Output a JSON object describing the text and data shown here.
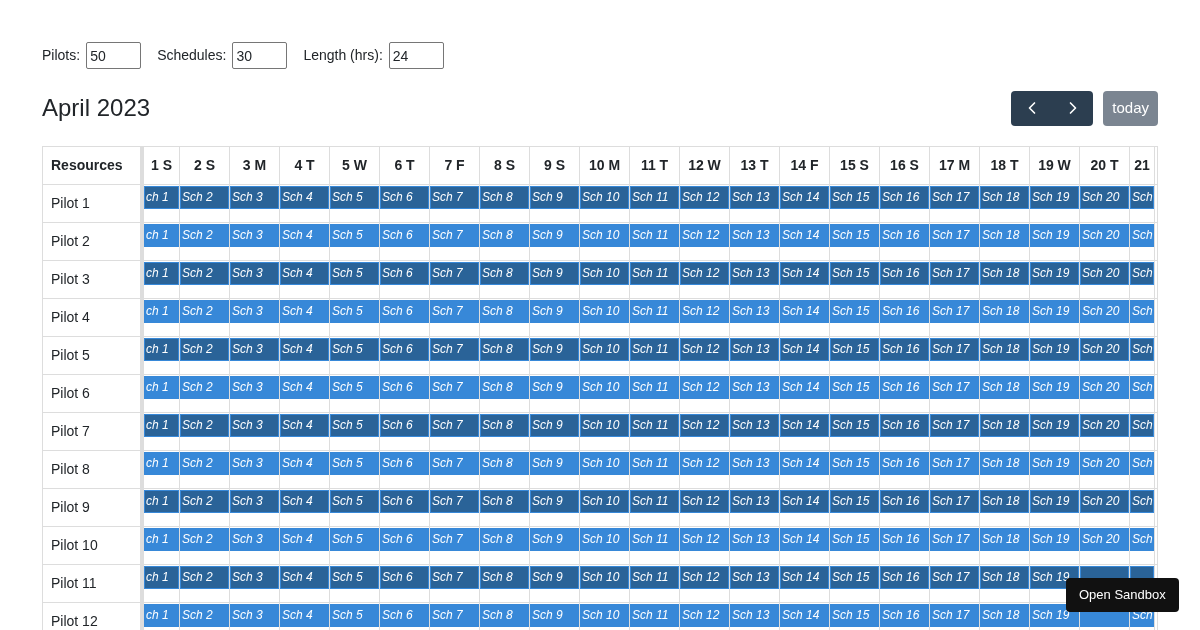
{
  "controls": [
    {
      "label": "Pilots:",
      "value": "50"
    },
    {
      "label": "Schedules:",
      "value": "30"
    },
    {
      "label": "Length (hrs):",
      "value": "24"
    }
  ],
  "title": "April 2023",
  "today_button": {
    "label": "today",
    "disabled": true
  },
  "resource_heading": "Resources",
  "days": [
    "1 S",
    "2 S",
    "3 M",
    "4 T",
    "5 W",
    "6 T",
    "7 F",
    "8 S",
    "9 S",
    "10 M",
    "11 T",
    "12 W",
    "13 T",
    "14 F",
    "15 S",
    "16 S",
    "17 M",
    "18 T",
    "19 W",
    "20 T",
    "21"
  ],
  "rows": [
    {
      "resource": "Pilot 1",
      "color": "#2a6398",
      "events": [
        "ch 1",
        "Sch 2",
        "Sch 3",
        "Sch 4",
        "Sch 5",
        "Sch 6",
        "Sch 7",
        "Sch 8",
        "Sch 9",
        "Sch 10",
        "Sch 11",
        "Sch 12",
        "Sch 13",
        "Sch 14",
        "Sch 15",
        "Sch 16",
        "Sch 17",
        "Sch 18",
        "Sch 19",
        "Sch 20",
        "Sch"
      ]
    },
    {
      "resource": "Pilot 2",
      "color": "#3788d8",
      "events": [
        "ch 1",
        "Sch 2",
        "Sch 3",
        "Sch 4",
        "Sch 5",
        "Sch 6",
        "Sch 7",
        "Sch 8",
        "Sch 9",
        "Sch 10",
        "Sch 11",
        "Sch 12",
        "Sch 13",
        "Sch 14",
        "Sch 15",
        "Sch 16",
        "Sch 17",
        "Sch 18",
        "Sch 19",
        "Sch 20",
        "Sch"
      ]
    },
    {
      "resource": "Pilot 3",
      "color": "#2a6398",
      "events": [
        "ch 1",
        "Sch 2",
        "Sch 3",
        "Sch 4",
        "Sch 5",
        "Sch 6",
        "Sch 7",
        "Sch 8",
        "Sch 9",
        "Sch 10",
        "Sch 11",
        "Sch 12",
        "Sch 13",
        "Sch 14",
        "Sch 15",
        "Sch 16",
        "Sch 17",
        "Sch 18",
        "Sch 19",
        "Sch 20",
        "Sch"
      ]
    },
    {
      "resource": "Pilot 4",
      "color": "#3788d8",
      "events": [
        "ch 1",
        "Sch 2",
        "Sch 3",
        "Sch 4",
        "Sch 5",
        "Sch 6",
        "Sch 7",
        "Sch 8",
        "Sch 9",
        "Sch 10",
        "Sch 11",
        "Sch 12",
        "Sch 13",
        "Sch 14",
        "Sch 15",
        "Sch 16",
        "Sch 17",
        "Sch 18",
        "Sch 19",
        "Sch 20",
        "Sch"
      ]
    },
    {
      "resource": "Pilot 5",
      "color": "#2a6398",
      "events": [
        "ch 1",
        "Sch 2",
        "Sch 3",
        "Sch 4",
        "Sch 5",
        "Sch 6",
        "Sch 7",
        "Sch 8",
        "Sch 9",
        "Sch 10",
        "Sch 11",
        "Sch 12",
        "Sch 13",
        "Sch 14",
        "Sch 15",
        "Sch 16",
        "Sch 17",
        "Sch 18",
        "Sch 19",
        "Sch 20",
        "Sch"
      ]
    },
    {
      "resource": "Pilot 6",
      "color": "#3788d8",
      "events": [
        "ch 1",
        "Sch 2",
        "Sch 3",
        "Sch 4",
        "Sch 5",
        "Sch 6",
        "Sch 7",
        "Sch 8",
        "Sch 9",
        "Sch 10",
        "Sch 11",
        "Sch 12",
        "Sch 13",
        "Sch 14",
        "Sch 15",
        "Sch 16",
        "Sch 17",
        "Sch 18",
        "Sch 19",
        "Sch 20",
        "Sch"
      ]
    },
    {
      "resource": "Pilot 7",
      "color": "#2a6398",
      "events": [
        "ch 1",
        "Sch 2",
        "Sch 3",
        "Sch 4",
        "Sch 5",
        "Sch 6",
        "Sch 7",
        "Sch 8",
        "Sch 9",
        "Sch 10",
        "Sch 11",
        "Sch 12",
        "Sch 13",
        "Sch 14",
        "Sch 15",
        "Sch 16",
        "Sch 17",
        "Sch 18",
        "Sch 19",
        "Sch 20",
        "Sch"
      ]
    },
    {
      "resource": "Pilot 8",
      "color": "#3788d8",
      "events": [
        "ch 1",
        "Sch 2",
        "Sch 3",
        "Sch 4",
        "Sch 5",
        "Sch 6",
        "Sch 7",
        "Sch 8",
        "Sch 9",
        "Sch 10",
        "Sch 11",
        "Sch 12",
        "Sch 13",
        "Sch 14",
        "Sch 15",
        "Sch 16",
        "Sch 17",
        "Sch 18",
        "Sch 19",
        "Sch 20",
        "Sch"
      ]
    },
    {
      "resource": "Pilot 9",
      "color": "#2a6398",
      "events": [
        "ch 1",
        "Sch 2",
        "Sch 3",
        "Sch 4",
        "Sch 5",
        "Sch 6",
        "Sch 7",
        "Sch 8",
        "Sch 9",
        "Sch 10",
        "Sch 11",
        "Sch 12",
        "Sch 13",
        "Sch 14",
        "Sch 15",
        "Sch 16",
        "Sch 17",
        "Sch 18",
        "Sch 19",
        "Sch 20",
        "Sch"
      ]
    },
    {
      "resource": "Pilot 10",
      "color": "#3788d8",
      "events": [
        "ch 1",
        "Sch 2",
        "Sch 3",
        "Sch 4",
        "Sch 5",
        "Sch 6",
        "Sch 7",
        "Sch 8",
        "Sch 9",
        "Sch 10",
        "Sch 11",
        "Sch 12",
        "Sch 13",
        "Sch 14",
        "Sch 15",
        "Sch 16",
        "Sch 17",
        "Sch 18",
        "Sch 19",
        "Sch 20",
        "Sch"
      ]
    },
    {
      "resource": "Pilot 11",
      "color": "#2a6398",
      "events": [
        "ch 1",
        "Sch 2",
        "Sch 3",
        "Sch 4",
        "Sch 5",
        "Sch 6",
        "Sch 7",
        "Sch 8",
        "Sch 9",
        "Sch 10",
        "Sch 11",
        "Sch 12",
        "Sch 13",
        "Sch 14",
        "Sch 15",
        "Sch 16",
        "Sch 17",
        "Sch 18",
        "Sch 19"
      ],
      "covered_events": [
        {
          "kind": "covered"
        },
        {
          "kind": "covered"
        }
      ]
    },
    {
      "resource": "Pilot 12",
      "color": "#3788d8",
      "events": [
        "ch 1",
        "Sch 2",
        "Sch 3",
        "Sch 4",
        "Sch 5",
        "Sch 6",
        "Sch 7",
        "Sch 8",
        "Sch 9",
        "Sch 10",
        "Sch 11",
        "Sch 12",
        "Sch 13",
        "Sch 14",
        "Sch 15",
        "Sch 16",
        "Sch 17",
        "Sch 18",
        "Sch 19"
      ],
      "covered_events": [
        {
          "kind": "covered"
        }
      ],
      "tail_events": [
        "Sch"
      ]
    }
  ],
  "tooltip": "Open Sandbox"
}
